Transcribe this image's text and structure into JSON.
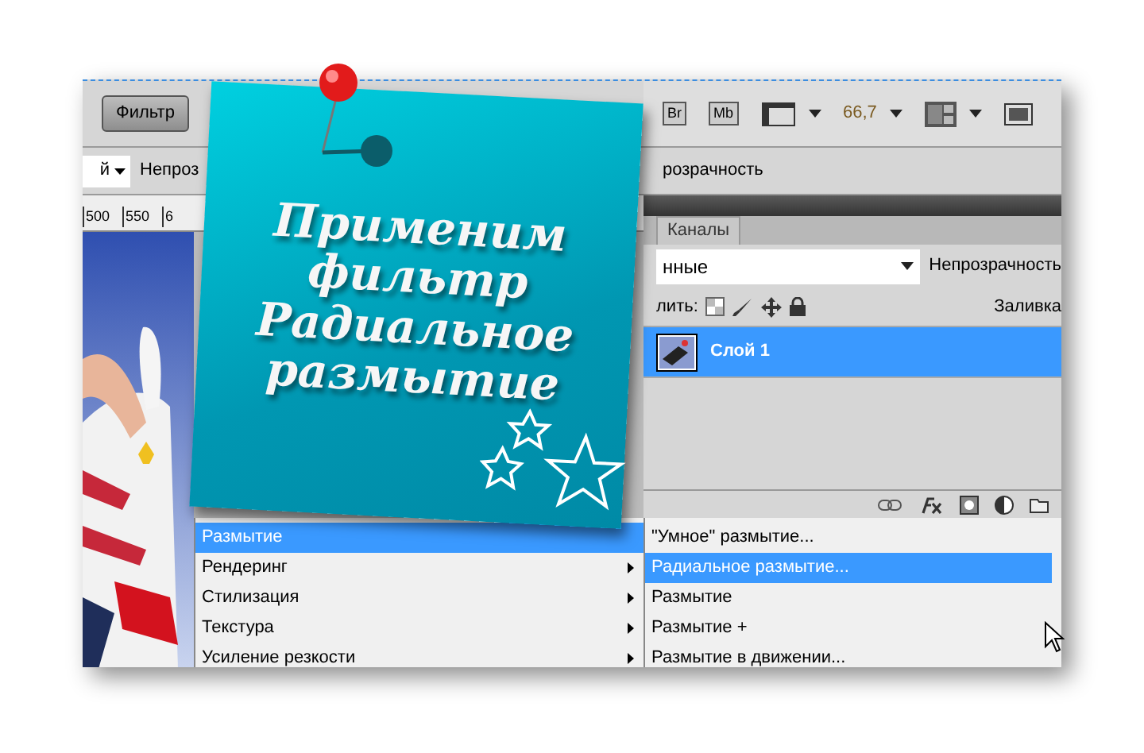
{
  "toolbar": {
    "filter_button": "Фильтр",
    "app_buttons": [
      "Br",
      "Mb"
    ],
    "zoom": "66,7"
  },
  "options_bar": {
    "mode_field": "й",
    "opacity_fragment": "Непроз",
    "opacity_fragment_right": "розрачность"
  },
  "ruler": {
    "ticks": [
      "500",
      "550",
      "6"
    ]
  },
  "layers_panel": {
    "tabs": [
      {
        "label": "Каналы",
        "selected": false
      }
    ],
    "blend_mode": "нные",
    "opacity_label": "Непрозрачность",
    "lock_label": "лить:",
    "fill_label": "Заливка",
    "layers": [
      {
        "name": "Слой 1",
        "selected": true
      }
    ]
  },
  "menu": {
    "items": [
      {
        "label": "Размытие",
        "selected": true,
        "arrow": false
      },
      {
        "label": "Рендеринг",
        "selected": false,
        "arrow": true
      },
      {
        "label": "Стилизация",
        "selected": false,
        "arrow": true
      },
      {
        "label": "Текстура",
        "selected": false,
        "arrow": true
      },
      {
        "label": "Усиление резкости",
        "selected": false,
        "arrow": true
      }
    ]
  },
  "submenu": {
    "items": [
      {
        "label": "\"Умное\" размытие...",
        "selected": false
      },
      {
        "label": "Радиальное размытие...",
        "selected": true
      },
      {
        "label": "Размытие",
        "selected": false
      },
      {
        "label": "Размытие +",
        "selected": false
      },
      {
        "label": "Размытие в движении...",
        "selected": false
      }
    ]
  },
  "note": {
    "lines": [
      "Применим",
      "фильтр",
      "Радиальное",
      "размытие"
    ]
  }
}
